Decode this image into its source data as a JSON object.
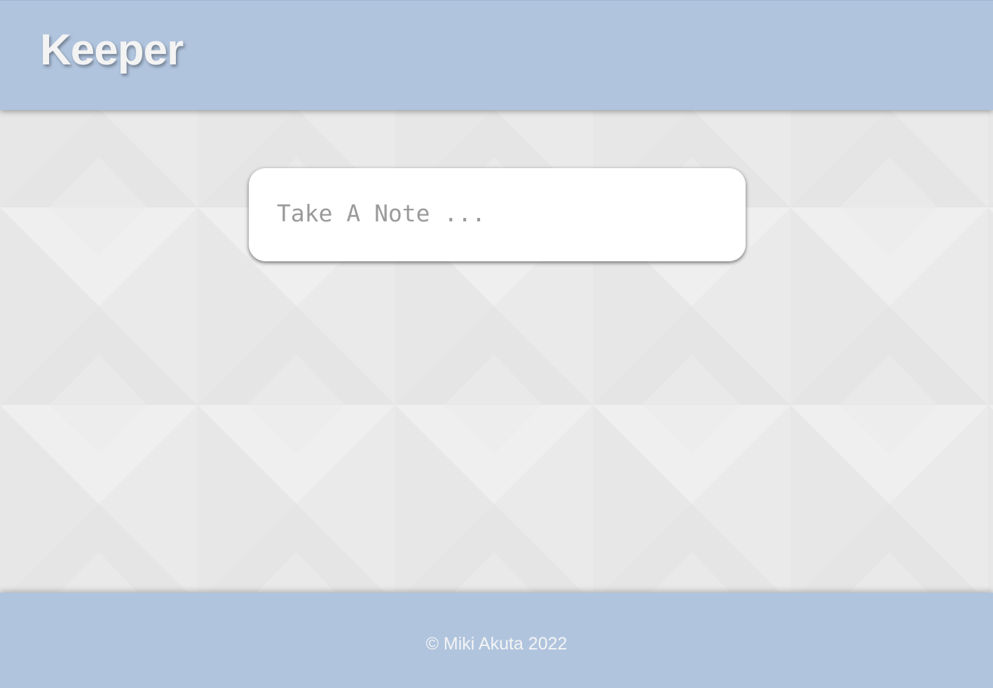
{
  "header": {
    "title": "Keeper"
  },
  "note_form": {
    "placeholder": "Take A Note ..."
  },
  "footer": {
    "copyright": "© Miki Akuta 2022"
  },
  "colors": {
    "bar": "#b0c4de",
    "background": "#ececec",
    "card": "#ffffff",
    "title_text": "#f3f3f3"
  }
}
